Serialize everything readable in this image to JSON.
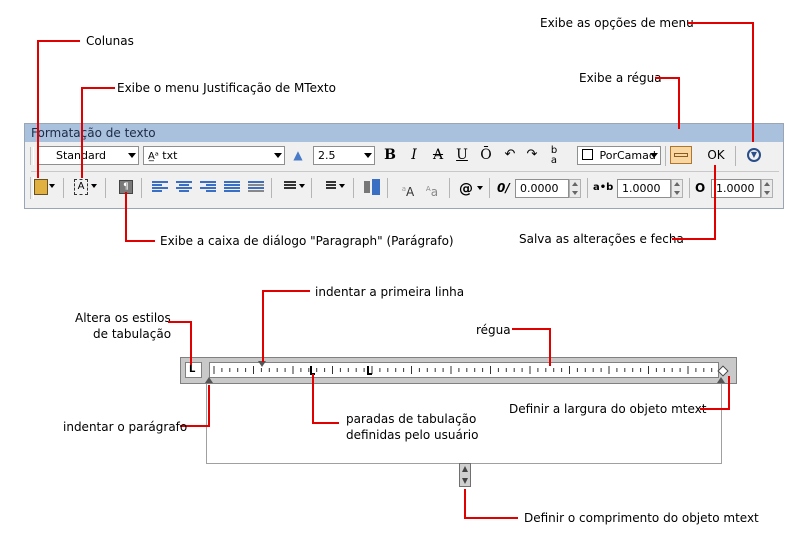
{
  "callouts": {
    "colunas": "Colunas",
    "justificacao": "Exibe o menu Justificação de MTexto",
    "opcoes_menu": "Exibe as opções de menu",
    "regua_toolbar": "Exibe a régua",
    "paragraph": "Exibe a caixa de diálogo \"Paragraph\" (Parágrafo)",
    "salva": "Salva as alterações e fecha",
    "estilos_tab_1": "Altera os estilos",
    "estilos_tab_2": "de tabulação",
    "primeira_linha": "indentar a primeira linha",
    "regua": "régua",
    "indentar_paragrafo": "indentar o parágrafo",
    "paradas_1": "paradas de tabulação",
    "paradas_2": "definidas pelo usuário",
    "largura": "Definir a largura do objeto mtext",
    "comprimento": "Definir o comprimento do objeto mtext"
  },
  "toolbar": {
    "title": "Formatação de texto",
    "style_value": "Standard",
    "font_value": "txt",
    "height_value": "2.5",
    "bold": "B",
    "italic": "I",
    "strike": "A",
    "underline": "U",
    "overline": "Ō",
    "color_value": "PorCamad",
    "ok_label": "OK",
    "oblique_value": "0.0000",
    "tracking_value": "1.0000",
    "width_value": "1.0000",
    "symbol_label": "@",
    "oblique_prefix": "0/",
    "tracking_prefix": "a•b",
    "width_prefix": "O"
  },
  "ruler": {
    "tab_selector": "L"
  }
}
